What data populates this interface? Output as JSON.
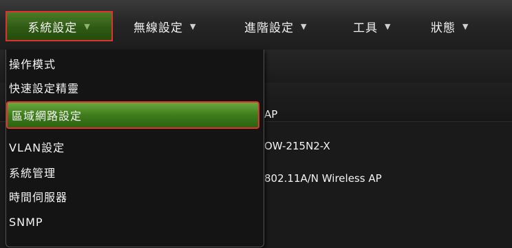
{
  "nav": {
    "items": [
      {
        "label": "系統設定",
        "caret": "▼"
      },
      {
        "label": "無線設定",
        "caret": "▼"
      },
      {
        "label": "進階設定",
        "caret": "▼"
      },
      {
        "label": "工具",
        "caret": "▼"
      },
      {
        "label": "狀態",
        "caret": "▼"
      }
    ]
  },
  "dropdown": {
    "items": [
      {
        "label": "操作模式"
      },
      {
        "label": "快速設定精靈"
      },
      {
        "label": "區域網路設定"
      },
      {
        "label": "VLAN設定"
      },
      {
        "label": "系統管理"
      },
      {
        "label": "時間伺服器"
      },
      {
        "label": "SNMP"
      }
    ]
  },
  "info": {
    "mode": "AP",
    "model": "OW-215N2-X",
    "description": "802.11A/N Wireless AP"
  },
  "colors": {
    "accent_green": "#3f7c1c",
    "highlight_border": "#e23131"
  }
}
